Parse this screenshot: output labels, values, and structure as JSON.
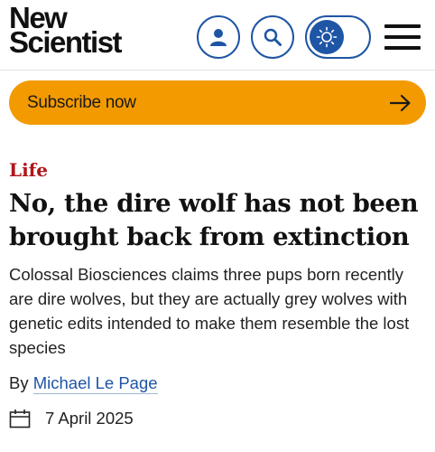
{
  "header": {
    "logo_line1": "New",
    "logo_line2": "Scientist",
    "icons": {
      "account": "user-icon",
      "search": "search-icon",
      "theme": "sun-icon",
      "menu": "hamburger-menu-icon"
    }
  },
  "subscribe": {
    "label": "Subscribe now",
    "icon": "arrow-right-icon"
  },
  "article": {
    "category": "Life",
    "headline": "No, the dire wolf has not been brought back from extinction",
    "standfirst": "Colossal Biosciences claims three pups born recently are dire wolves, but they are actually grey wolves with genetic edits intended to make them resemble the lost species",
    "byline_prefix": "By",
    "author": "Michael Le Page",
    "date": "7 April 2025",
    "date_icon": "calendar-icon"
  },
  "colors": {
    "brand_blue": "#1f55a5",
    "subscribe_orange": "#f39a00",
    "category_red": "#b0151a"
  }
}
